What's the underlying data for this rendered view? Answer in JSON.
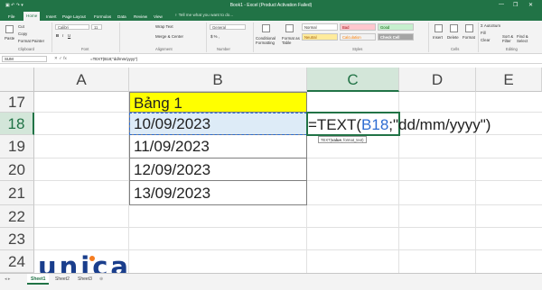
{
  "window": {
    "title": "Book1 - Excel (Product Activation Failed)",
    "quick_access": "▣ ↶ ↷ ▾",
    "minimize": "—",
    "restore": "❐",
    "close": "✕"
  },
  "tabs": [
    {
      "label": "File"
    },
    {
      "label": "Home",
      "active": true
    },
    {
      "label": "Insert"
    },
    {
      "label": "Page Layout"
    },
    {
      "label": "Formulas"
    },
    {
      "label": "Data"
    },
    {
      "label": "Review"
    },
    {
      "label": "View"
    }
  ],
  "tell_me": "♀ Tell me what you want to do...",
  "ribbon": {
    "clipboard": {
      "cut": "Cut",
      "copy": "Copy",
      "format_painter": "Format Painter",
      "paste": "Paste",
      "group": "Clipboard"
    },
    "font": {
      "name": "Calibri",
      "size": "11",
      "group": "Font"
    },
    "alignment": {
      "wrap": "Wrap Text",
      "merge": "Merge & Center",
      "group": "Alignment"
    },
    "number": {
      "format": "General",
      "group": "Number"
    },
    "styles": {
      "conditional": "Conditional Formatting",
      "format_table": "Format as Table",
      "normal": "Normal",
      "bad": "Bad",
      "good": "Good",
      "neutral": "Neutral",
      "calculation": "Calculation",
      "check_cell": "Check Cell",
      "group": "Styles"
    },
    "cells": {
      "insert": "Insert",
      "delete": "Delete",
      "format": "Format",
      "group": "Cells"
    },
    "editing": {
      "autosum": "Σ AutoSum",
      "fill": "Fill",
      "clear": "Clear",
      "sort": "Sort & Filter",
      "find": "Find & Select",
      "group": "Editing"
    }
  },
  "formula_bar": {
    "name_box": "SUM",
    "buttons": "✕ ✓ fx",
    "formula": "=TEXT(B18;\"dd/mm/yyyy\")"
  },
  "columns": [
    "A",
    "B",
    "C",
    "D",
    "E"
  ],
  "rows": [
    "17",
    "18",
    "19",
    "20",
    "21",
    "22",
    "23",
    "24"
  ],
  "cells": {
    "b17": "Bảng 1",
    "b18": "10/09/2023",
    "b19": "11/09/2023",
    "b20": "12/09/2023",
    "b21": "13/09/2023",
    "c18_prefix": "=TEXT(",
    "c18_ref": "B18",
    "c18_suffix": ";\"dd/mm/yyyy\")",
    "tooltip_fn": "TEXT(",
    "tooltip_arg1": "value",
    "tooltip_rest": ", format_text)"
  },
  "sheets": [
    {
      "label": "Sheet1",
      "active": true
    },
    {
      "label": "Sheet2"
    },
    {
      "label": "Sheet3"
    }
  ],
  "add_sheet": "⊕",
  "logo": "unica",
  "colors": {
    "excel_green": "#217346",
    "highlight_yellow": "#ffff00",
    "ref_blue": "#2d6cd1",
    "logo_blue": "#1a3e8c",
    "logo_orange": "#f57c20"
  }
}
